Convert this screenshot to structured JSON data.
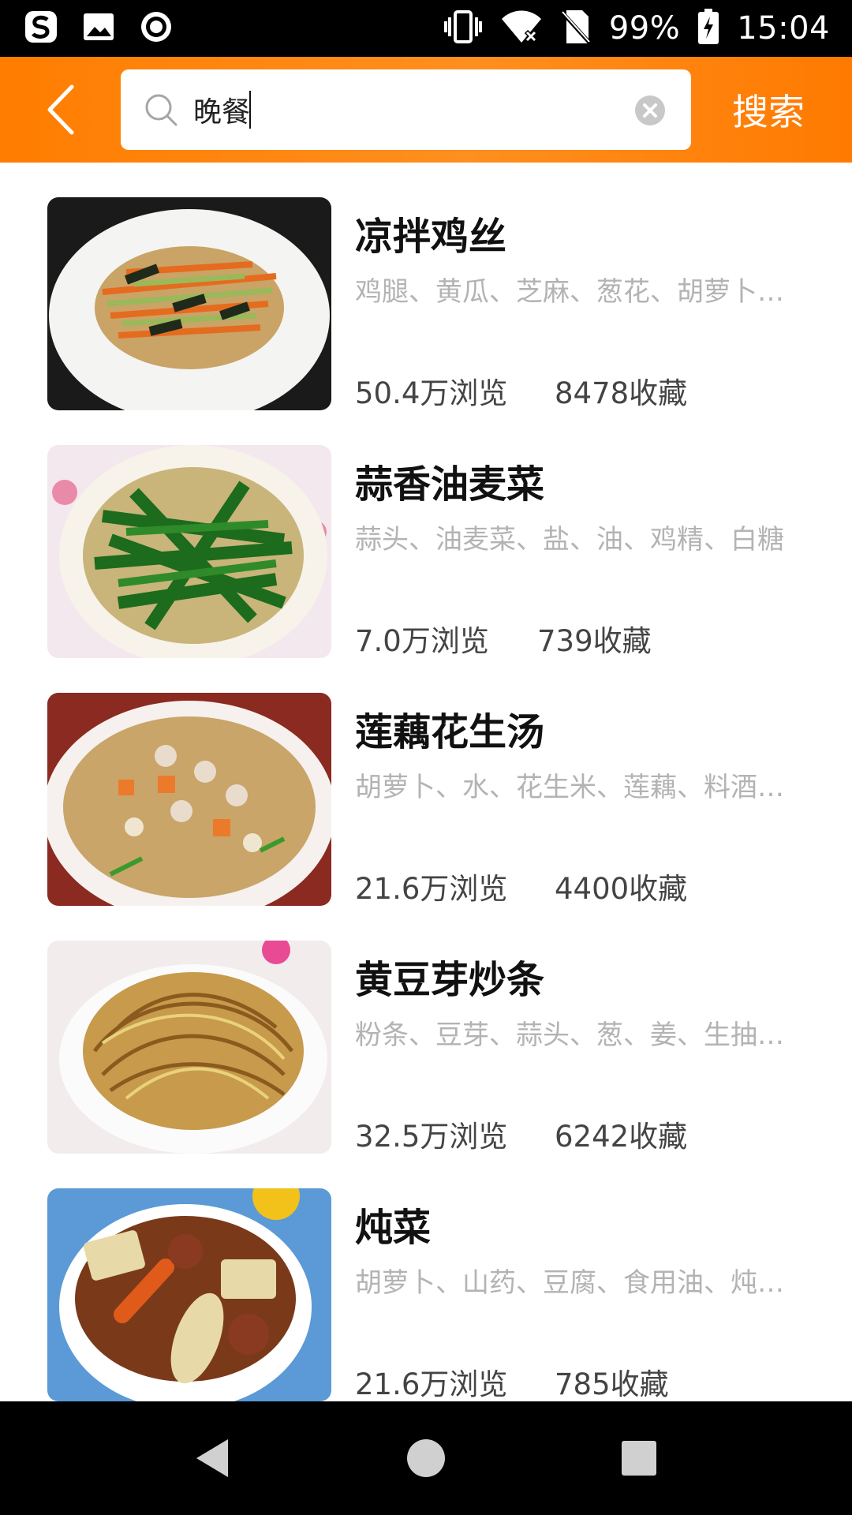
{
  "status_bar": {
    "battery": "99%",
    "time": "15:04",
    "left_icons": [
      "sogou-icon",
      "image-icon",
      "record-icon"
    ],
    "right_icons": [
      "vibrate-icon",
      "wifi-icon",
      "no-sim-icon",
      "battery-icon"
    ]
  },
  "header": {
    "back_icon": "chevron-left-icon",
    "search": {
      "value": "晚餐",
      "placeholder": ""
    },
    "search_button_label": "搜索"
  },
  "recipes": [
    {
      "title": "凉拌鸡丝",
      "ingredients": "鸡腿、黄瓜、芝麻、葱花、胡萝卜、生抽",
      "views": "50.4万浏览",
      "favorites": "8478收藏"
    },
    {
      "title": "蒜香油麦菜",
      "ingredients": "蒜头、油麦菜、盐、油、鸡精、白糖",
      "views": "7.0万浏览",
      "favorites": "739收藏"
    },
    {
      "title": "莲藕花生汤",
      "ingredients": "胡萝卜、水、花生米、莲藕、料酒、盐",
      "views": "21.6万浏览",
      "favorites": "4400收藏"
    },
    {
      "title": "黄豆芽炒条",
      "ingredients": "粉条、豆芽、蒜头、葱、姜、生抽、老抽",
      "views": "32.5万浏览",
      "favorites": "6242收藏"
    },
    {
      "title": "炖菜",
      "ingredients": "胡萝卜、山药、豆腐、食用油、炖肉料",
      "views": "21.6万浏览",
      "favorites": "785收藏"
    }
  ],
  "colors": {
    "header_orange": "#ff8000",
    "title_text": "#111111",
    "ingredient_text": "#b3b3b3",
    "stat_text": "#444444"
  }
}
